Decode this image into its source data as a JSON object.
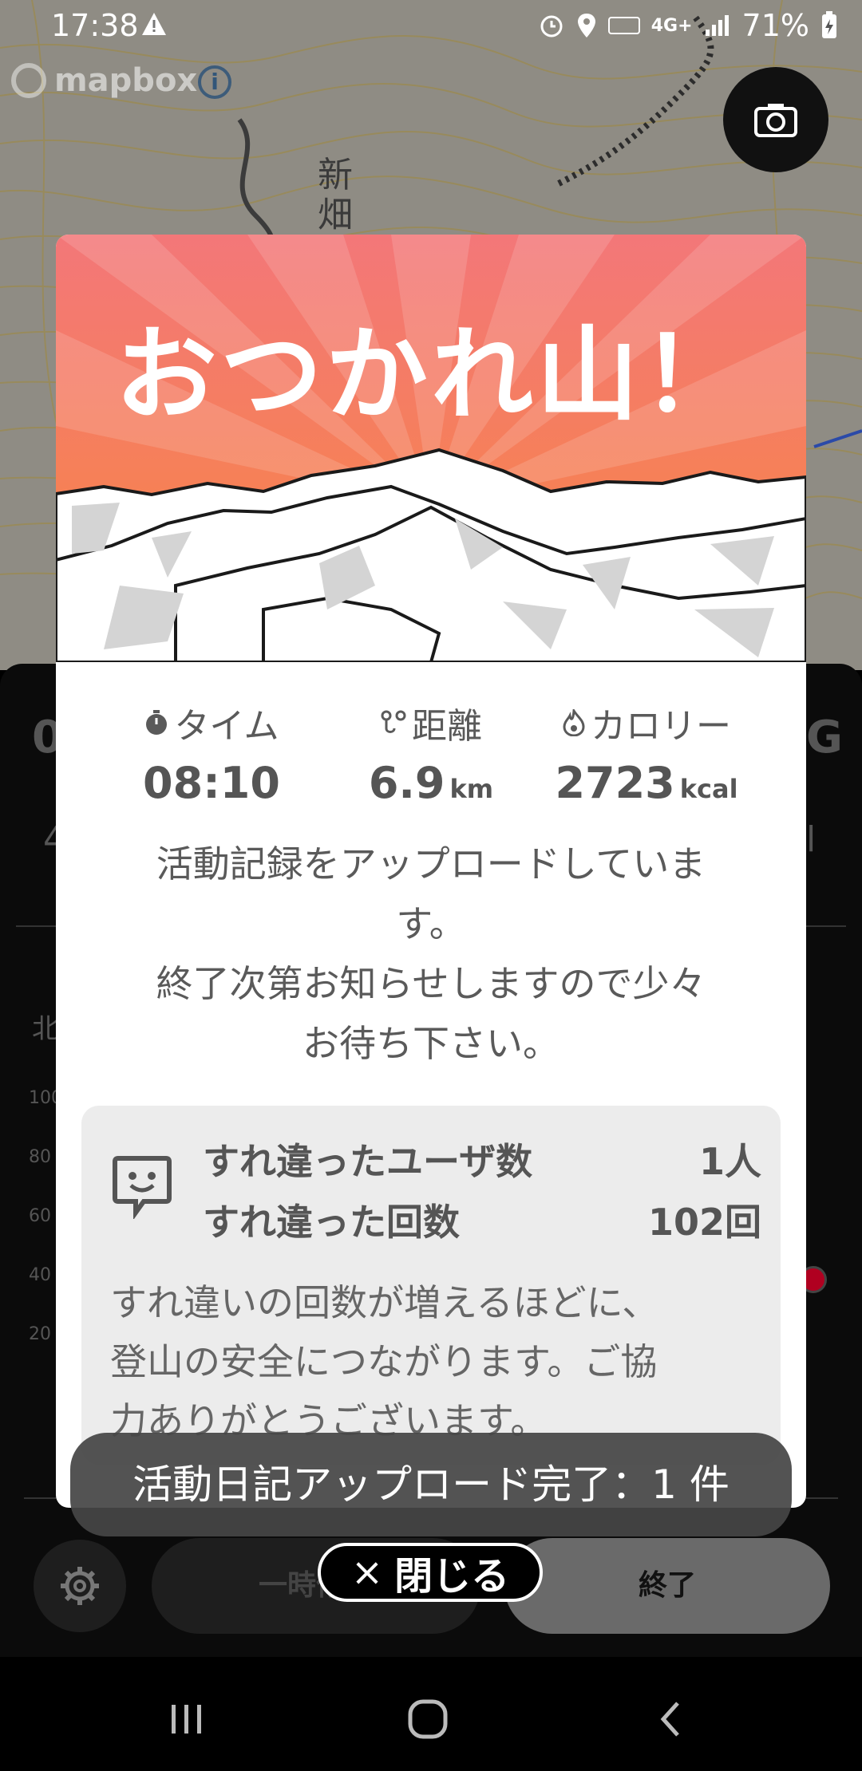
{
  "status_bar": {
    "time": "17:38",
    "network": "4G+",
    "battery": "71%"
  },
  "map": {
    "place_label": "新畑",
    "attribution": "mapbox",
    "info_glyph": "i"
  },
  "background_panel": {
    "peek_left": "0",
    "peek_left_sub": "4",
    "peek_right": "G",
    "peek_right_sub": "l",
    "direction_label": "北",
    "axis_labels": [
      "100",
      "80",
      "60",
      "40",
      "20"
    ],
    "pause_label": "一時停止",
    "end_label": "終了"
  },
  "modal": {
    "title": "おつかれ山！",
    "stats": {
      "time_label": "タイム",
      "time_value": "08:10",
      "distance_label": "距離",
      "distance_value": "6.9",
      "distance_unit": "km",
      "calorie_label": "カロリー",
      "calorie_value": "2723",
      "calorie_unit": "kcal"
    },
    "message_line1": "活動記録をアップロードしていま",
    "message_line2": "す。",
    "message_line3": "終了次第お知らせしますので少々",
    "message_line4": "お待ち下さい。",
    "encounter": {
      "users_label": "すれ違ったユーザ数",
      "users_value": "1人",
      "count_label": "すれ違った回数",
      "count_value": "102回",
      "desc_line1": "すれ違いの回数が増えるほどに、",
      "desc_line2": "登山の安全につながります。ご協",
      "desc_line3": "力ありがとうございます。"
    }
  },
  "toast": "活動日記アップロード完了：1 件",
  "close_button": {
    "glyph": "×",
    "label": "閉じる"
  },
  "icons": {
    "camera": "camera-icon",
    "alert": "alert-icon",
    "timer": "timer-icon",
    "route": "route-icon",
    "flame": "flame-icon",
    "encounter": "encounter-face-icon",
    "settings": "gear-icon"
  },
  "colors": {
    "banner_top": "#f37779",
    "banner_bottom": "#f8873f",
    "toast_bg": "#464646",
    "end_button": "#6a6a6a"
  }
}
